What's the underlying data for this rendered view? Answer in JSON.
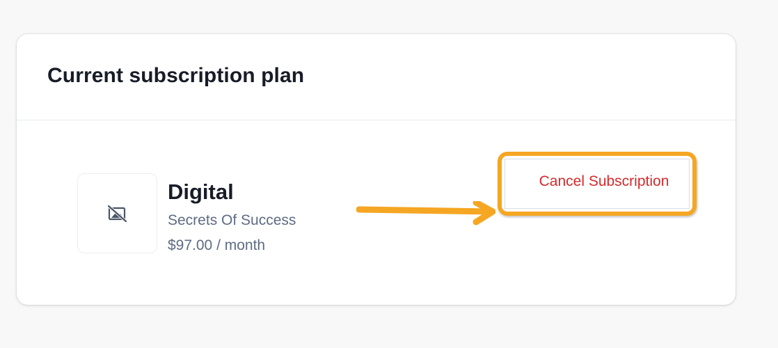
{
  "card": {
    "title": "Current subscription plan"
  },
  "plan": {
    "thumbnail_icon": "image-off-icon",
    "name": "Digital",
    "product": "Secrets Of Success",
    "price": "$97.00 / month"
  },
  "actions": {
    "cancel_label": "Cancel Subscription"
  },
  "annotation": {
    "arrow_icon": "arrow-right-icon",
    "highlight_color": "#f5a623"
  },
  "colors": {
    "danger": "#d42a2a",
    "muted_text": "#5d6b82",
    "heading": "#171c27"
  }
}
